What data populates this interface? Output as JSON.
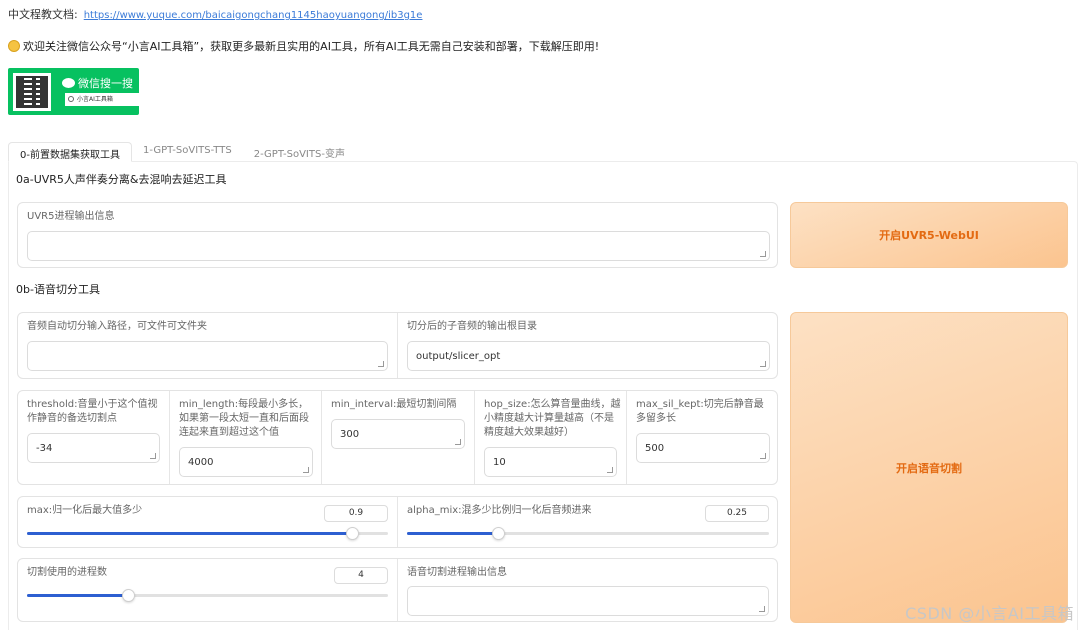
{
  "header": {
    "doc_label": "中文程教文档:",
    "doc_url": "https://www.yuque.com/baicaigongchang1145haoyuangong/ib3g1e",
    "welcome": "欢迎关注微信公众号“小言AI工具箱”，获取更多最新且实用的AI工具，所有AI工具无需自己安装和部署，下载解压即用!"
  },
  "wechat": {
    "title": "微信搜一搜",
    "search_text": "小言AI工具箱"
  },
  "tabs": [
    {
      "label": "0-前置数据集获取工具"
    },
    {
      "label": "1-GPT-SoVITS-TTS"
    },
    {
      "label": "2-GPT-SoVITS-变声"
    }
  ],
  "uvr5": {
    "section_title": "0a-UVR5人声伴奏分离&去混响去延迟工具",
    "output_label": "UVR5进程输出信息",
    "output_value": "",
    "button_label": "开启UVR5-WebUI"
  },
  "slicer": {
    "section_title": "0b-语音切分工具",
    "input_path_label": "音频自动切分输入路径，可文件可文件夹",
    "input_path_value": "",
    "output_dir_label": "切分后的子音频的输出根目录",
    "output_dir_value": "output/slicer_opt",
    "threshold_label": "threshold:音量小于这个值视作静音的备选切割点",
    "threshold_value": "-34",
    "min_length_label": "min_length:每段最小多长，如果第一段太短一直和后面段连起来直到超过这个值",
    "min_length_value": "4000",
    "min_interval_label": "min_interval:最短切割间隔",
    "min_interval_value": "300",
    "hop_size_label": "hop_size:怎么算音量曲线，越小精度越大计算量越高（不是精度越大效果越好）",
    "hop_size_value": "10",
    "max_sil_kept_label": "max_sil_kept:切完后静音最多留多长",
    "max_sil_kept_value": "500",
    "max_label": "max:归一化后最大值多少",
    "max_value": "0.9",
    "max_fraction": 0.9,
    "alpha_mix_label": "alpha_mix:混多少比例归一化后音频进来",
    "alpha_mix_value": "0.25",
    "alpha_mix_fraction": 0.25,
    "n_process_label": "切割使用的进程数",
    "n_process_value": "4",
    "n_process_fraction": 0.28,
    "output_info_label": "语音切割进程输出信息",
    "output_info_value": "",
    "button_label": "开启语音切割"
  },
  "watermark": "CSDN @小言AI工具箱"
}
